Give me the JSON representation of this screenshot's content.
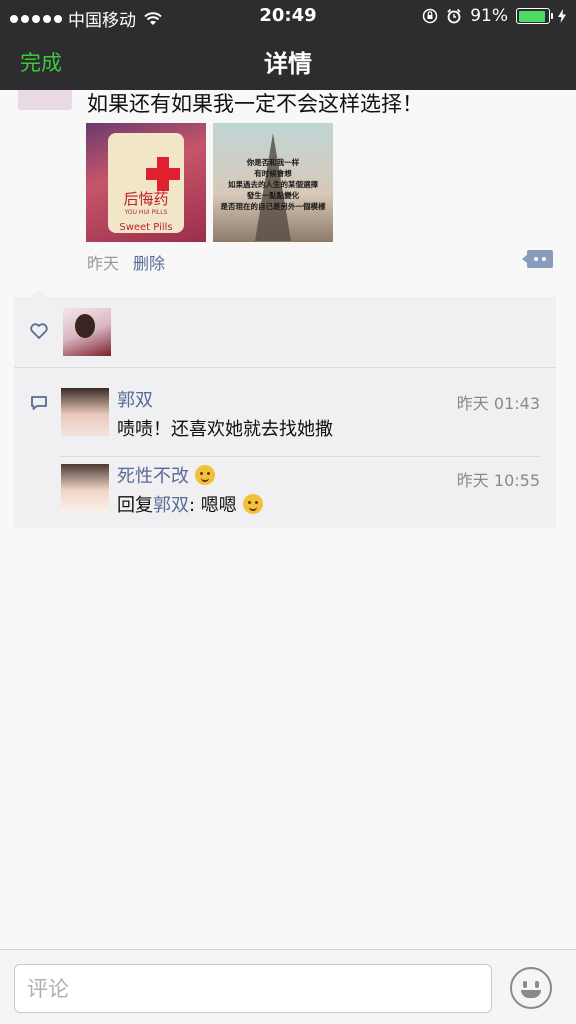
{
  "status_bar": {
    "carrier": "中国移动",
    "time": "20:49",
    "battery": "91%",
    "battery_level": 0.91,
    "signal_dots": 5
  },
  "nav": {
    "done_label": "完成",
    "title": "详情"
  },
  "post": {
    "text": "如果还有如果我一定不会这样选择！",
    "photos": [
      {
        "label_main": "后悔药",
        "label_small": "YOU HUI PILLS",
        "label_en": "Sweet Pills"
      },
      {
        "lines": [
          "你是否和我一样",
          "有时候會想",
          "如果過去的人生的某個選擇",
          "發生一點點變化",
          "是否現在的自己是另外一個模樣"
        ]
      }
    ],
    "time": "昨天",
    "delete_label": "删除"
  },
  "comments": [
    {
      "name": "郭双",
      "time": "昨天 01:43",
      "text": "啧啧！还喜欢她就去找她撒"
    },
    {
      "name": "死性不改",
      "time": "昨天 10:55",
      "reply_prefix": "回复",
      "reply_to": "郭双",
      "reply_text": ": 嗯嗯"
    }
  ],
  "input": {
    "placeholder": "评论"
  },
  "colors": {
    "bar": "#2d2d2f",
    "accent_green": "#3ec73e",
    "link_blue": "#576b95",
    "battery_green": "#4cd964"
  }
}
